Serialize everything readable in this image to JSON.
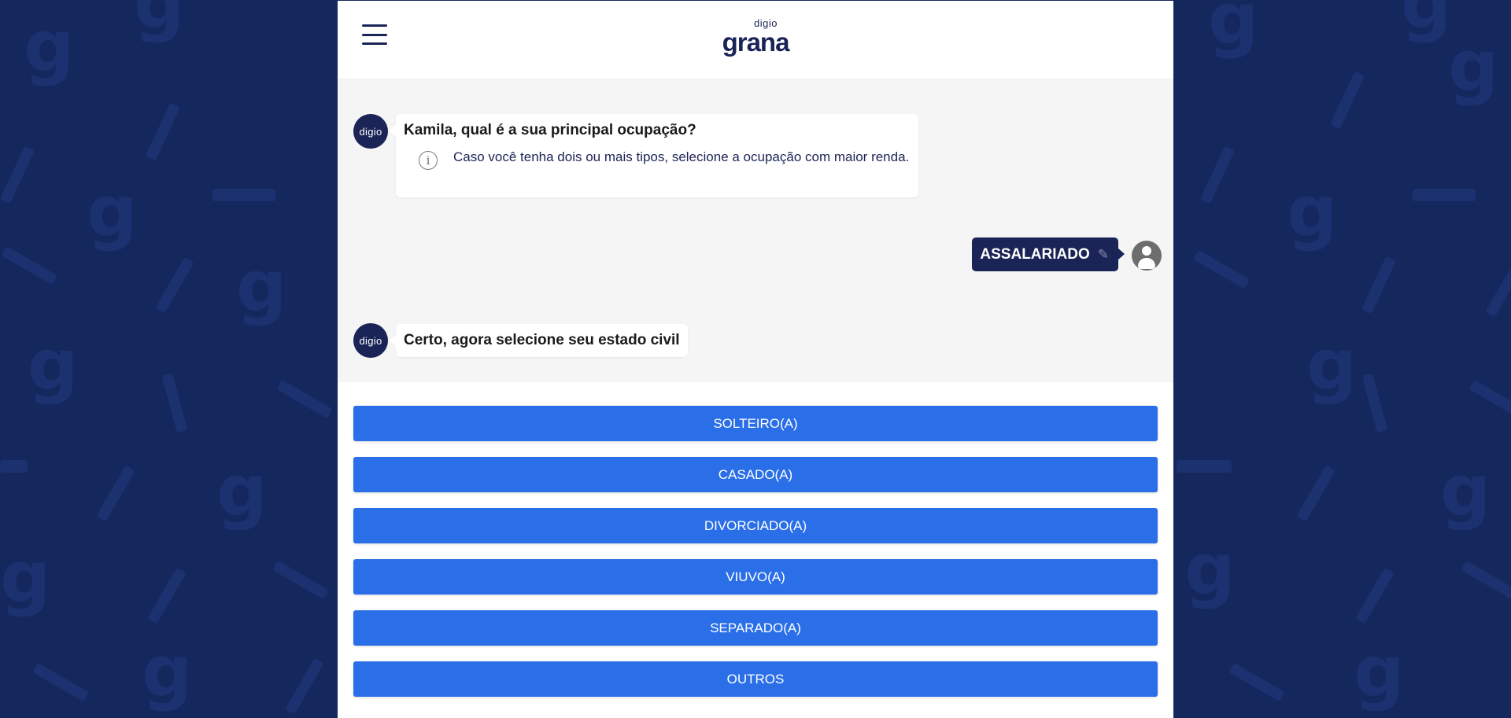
{
  "header": {
    "logo_small": "digio",
    "logo_big": "grana"
  },
  "chat": {
    "bot_avatar_label": "digio",
    "question1": {
      "title": "Kamila, qual é a sua principal ocupação?",
      "info": "Caso você tenha dois ou mais tipos, selecione a ocupação com maior renda."
    },
    "user_answer": "ASSALARIADO",
    "question2": {
      "title": "Certo, agora selecione seu estado civil"
    }
  },
  "options": [
    "SOLTEIRO(A)",
    "CASADO(A)",
    "DIVORCIADO(A)",
    "VIUVO(A)",
    "SEPARADO(A)",
    "OUTROS"
  ],
  "colors": {
    "background": "#14285e",
    "brand_navy": "#1a2456",
    "option_button": "#2a6fe8",
    "chat_background": "#f5f5f5"
  },
  "icons": {
    "menu": "hamburger-menu-icon",
    "info": "info-circle-icon",
    "edit": "pencil-icon",
    "user": "user-avatar-icon"
  }
}
